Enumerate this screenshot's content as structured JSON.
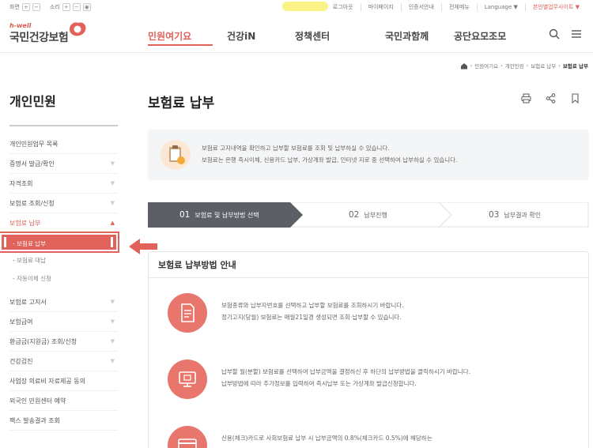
{
  "utility": {
    "zoom_label": "화면",
    "sound_label": "소리",
    "plus": "+",
    "minus": "−",
    "links": [
      "로그아웃",
      "마이페이지",
      "인증서안내",
      "전체메뉴",
      "Language ▼",
      "본인별업무사이트 ▼"
    ]
  },
  "header": {
    "logo_small": "h-well",
    "logo_big": "국민건강보험",
    "nav": [
      "민원여기요",
      "건강iN",
      "정책센터",
      "국민과함께",
      "공단요모조모"
    ]
  },
  "breadcrumb": [
    "민원여기요",
    "개인민원",
    "보험료 납부",
    "보험료 납부"
  ],
  "sidebar": {
    "title": "개인민원",
    "items": [
      {
        "label": "개인민원업무 목록"
      },
      {
        "label": "증명서 발급/확인",
        "chevron": "▼"
      },
      {
        "label": "자격조회",
        "chevron": "▼"
      },
      {
        "label": "보험료 조회/신청",
        "chevron": "▼"
      },
      {
        "label": "보험료 납부",
        "chevron": "▲"
      }
    ],
    "subs": [
      "- 보험료 납부",
      "- 보험료 대납",
      "- 자동이체 신청"
    ],
    "items2": [
      {
        "label": "보험료 고지서",
        "chevron": "▼"
      },
      {
        "label": "보험급여",
        "chevron": "▼"
      },
      {
        "label": "환급금(지원금) 조회/신청",
        "chevron": "▼"
      },
      {
        "label": "건강검진",
        "chevron": "▼"
      },
      {
        "label": "사업장 의료비 자료제공 동의"
      },
      {
        "label": "외국인 민원센터 예약"
      },
      {
        "label": "팩스 발송결과 조회"
      }
    ]
  },
  "main": {
    "title": "보험료 납부",
    "info_line1": "보험료 고지내역을 확인하고 납부할 보험료를 조회 및 납부하실 수 있습니다.",
    "info_line2": "보험료는 은행 즉시이체, 신용카드 납부, 가상계좌 발급, 인터넷 지로 중 선택하여 납부하실 수 있습니다.",
    "steps": [
      {
        "num": "01",
        "label": "보험료 및 납부방법 선택"
      },
      {
        "num": "02",
        "label": "납부진행"
      },
      {
        "num": "03",
        "label": "납부결과 확인"
      }
    ],
    "guide_title": "보험료 납부방법 안내",
    "guide_rows": [
      {
        "icon": "document-icon",
        "l1": "보험종류와 납부자번호를 선택하고 납부할 보험료를 조회하시기 바랍니다.",
        "l2": "정기고지(당월) 보험료는 매월21일경 생성되면 조회·납부할 수 있습니다."
      },
      {
        "icon": "monitor-icon",
        "l1": "납부할 월(분할) 보험료를 선택하여 납부금액을 결정하신 후 하단의 납부방법을 클릭하시기 바랍니다.",
        "l2": "납부방법에 따라 추가정보를 입력하여 즉시납부 또는 가상계좌 발급신청합니다."
      },
      {
        "icon": "card-icon",
        "l1": "신용(체크)카드로 사회보험료 납부 시 납부금액의 0.8%(체크카드 0.5%)에 해당하는",
        "l2": ""
      }
    ]
  },
  "colors": {
    "accent": "#e0625a",
    "step_active": "#5d5f66",
    "info_bg": "#f4f5f7"
  }
}
